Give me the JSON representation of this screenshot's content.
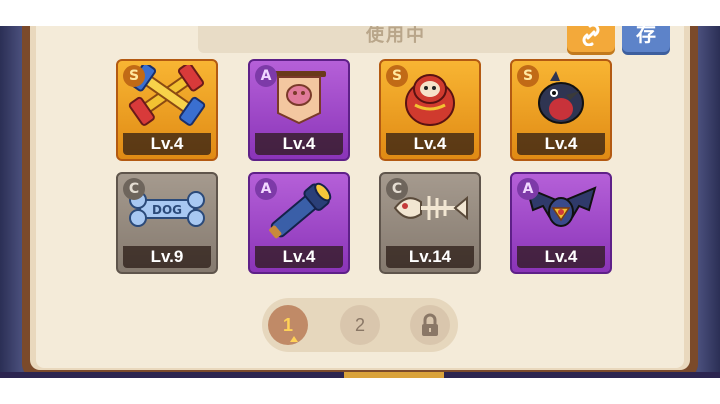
{
  "header": {
    "tab_label": "使用中",
    "share_button_icon": "link-icon",
    "save_button_label": "存"
  },
  "colors": {
    "rarity_S": "#f3a526",
    "rarity_A": "#9d45c8",
    "rarity_C": "#958a7e",
    "pager_active": "#c08a67"
  },
  "items": [
    {
      "rarity": "S",
      "level": "Lv.4",
      "icon": "golden-twin-hammer-icon"
    },
    {
      "rarity": "A",
      "level": "Lv.4",
      "icon": "hanging-banner-icon"
    },
    {
      "rarity": "S",
      "level": "Lv.4",
      "icon": "red-daruma-doll-icon"
    },
    {
      "rarity": "S",
      "level": "Lv.4",
      "icon": "black-crow-icon"
    },
    {
      "rarity": "C",
      "level": "Lv.9",
      "icon": "dog-bone-icon"
    },
    {
      "rarity": "A",
      "level": "Lv.4",
      "icon": "telescope-icon"
    },
    {
      "rarity": "C",
      "level": "Lv.14",
      "icon": "fish-skeleton-icon"
    },
    {
      "rarity": "A",
      "level": "Lv.4",
      "icon": "bat-icon"
    }
  ],
  "pager": {
    "pages": [
      "1",
      "2"
    ],
    "active_page": "1",
    "locked_icon": "lock-icon"
  }
}
